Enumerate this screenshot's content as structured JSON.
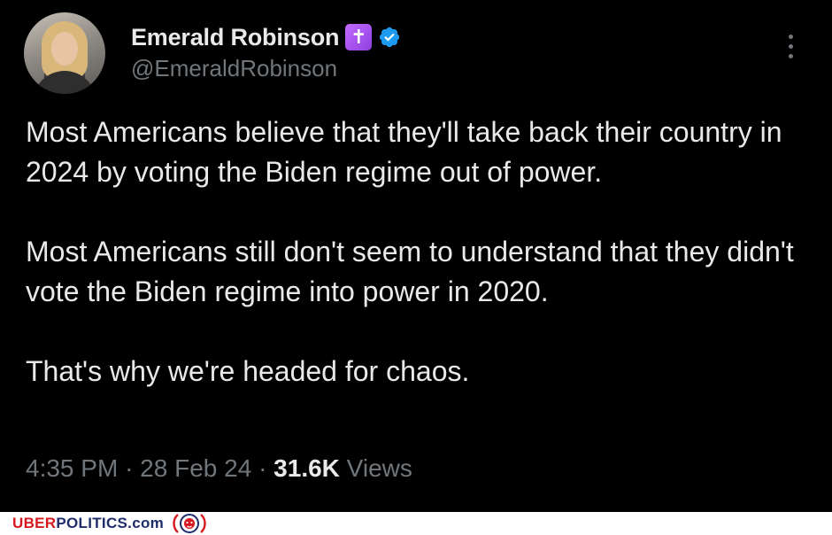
{
  "tweet": {
    "display_name": "Emerald Robinson",
    "handle": "@EmeraldRobinson",
    "badge_cross": "✝",
    "paragraphs": [
      "Most Americans believe that they'll take back their country in 2024 by voting the Biden regime out of power.",
      "Most Americans still don't seem to understand that they didn't vote the Biden regime into power in 2020.",
      "That's why we're headed for chaos."
    ],
    "time": "4:35 PM",
    "separator": "·",
    "date": "28 Feb 24",
    "views_count": "31.6K",
    "views_label": "Views"
  },
  "footer": {
    "logo_part1": "UBER",
    "logo_part2": "POLITICS",
    "logo_part3": ".com"
  },
  "colors": {
    "background": "#000000",
    "text_primary": "#e7e9ea",
    "text_secondary": "#71767b",
    "verified_blue": "#1d9bf0",
    "logo_red": "#d7191f",
    "logo_blue": "#1f2d6b"
  },
  "icons": {
    "verified": "verified-check-icon",
    "more": "more-vertical-icon",
    "cross": "latin-cross-icon"
  }
}
